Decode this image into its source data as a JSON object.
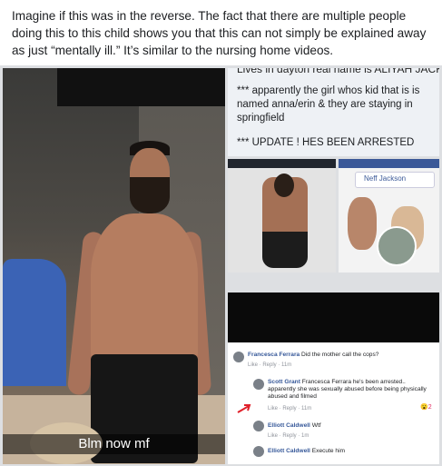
{
  "post": {
    "text": "Imagine if this was in the reverse. The fact that there are multiple people doing this to this child shows you that this can not simply be explained away as just “mentally ill.” It’s similar to the nursing home videos."
  },
  "left_photo": {
    "caption": "Blm now mf"
  },
  "text_panel": {
    "cut_line": "Lives in dayton real name is ALIYAH JACKSON",
    "line1": "*** apparently the girl whos kid that is is named anna/erin & they are staying in springfield",
    "line2": "*** UPDATE ! HES BEEN ARRESTED"
  },
  "phone_b": {
    "search_value": "Neff Jackson"
  },
  "comments": [
    {
      "name": "Francesca Ferrara",
      "text": "Did the mother call the cops?",
      "meta": "Like · Reply · 11m"
    },
    {
      "name": "Scott Grant",
      "text": "Francesca Ferrara he's been arrested.. apparently she was sexually abused before being physically abused and filmed",
      "meta": "Like · Reply · 11m",
      "reaction_count": "2"
    },
    {
      "name": "Elliott Caldwell",
      "text": "Wtf",
      "meta": "Like · Reply · 1m"
    },
    {
      "name": "Elliott Caldwell",
      "text": "Execute him",
      "meta": ""
    }
  ],
  "colors": {
    "name_link": "#365899",
    "arrow": "#e0202a"
  }
}
